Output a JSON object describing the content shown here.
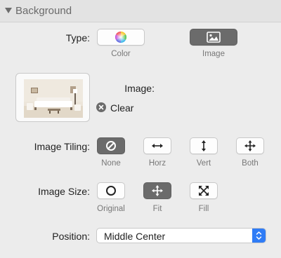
{
  "section": {
    "title": "Background"
  },
  "type_row": {
    "label": "Type:",
    "options": [
      {
        "caption": "Color",
        "icon": "color-wheel-icon",
        "selected": false
      },
      {
        "caption": "Image",
        "icon": "image-icon",
        "selected": true
      }
    ]
  },
  "image_row": {
    "label": "Image:",
    "clear_label": "Clear",
    "thumbnail": "living-room-image-thumbnail"
  },
  "tiling_row": {
    "label": "Image Tiling:",
    "options": [
      {
        "caption": "None",
        "icon": "none-slash-icon",
        "selected": true
      },
      {
        "caption": "Horz",
        "icon": "horizontal-arrows-icon",
        "selected": false
      },
      {
        "caption": "Vert",
        "icon": "vertical-arrows-icon",
        "selected": false
      },
      {
        "caption": "Both",
        "icon": "move-arrows-icon",
        "selected": false
      }
    ]
  },
  "size_row": {
    "label": "Image Size:",
    "options": [
      {
        "caption": "Original",
        "icon": "circle-icon",
        "selected": false
      },
      {
        "caption": "Fit",
        "icon": "move-arrows-icon",
        "selected": true
      },
      {
        "caption": "Fill",
        "icon": "expand-arrows-icon",
        "selected": false
      }
    ]
  },
  "position_row": {
    "label": "Position:",
    "value": "Middle Center"
  },
  "colors": {
    "accent": "#2f7cf6",
    "selected_button": "#6b6b6b",
    "panel": "#ececec"
  }
}
